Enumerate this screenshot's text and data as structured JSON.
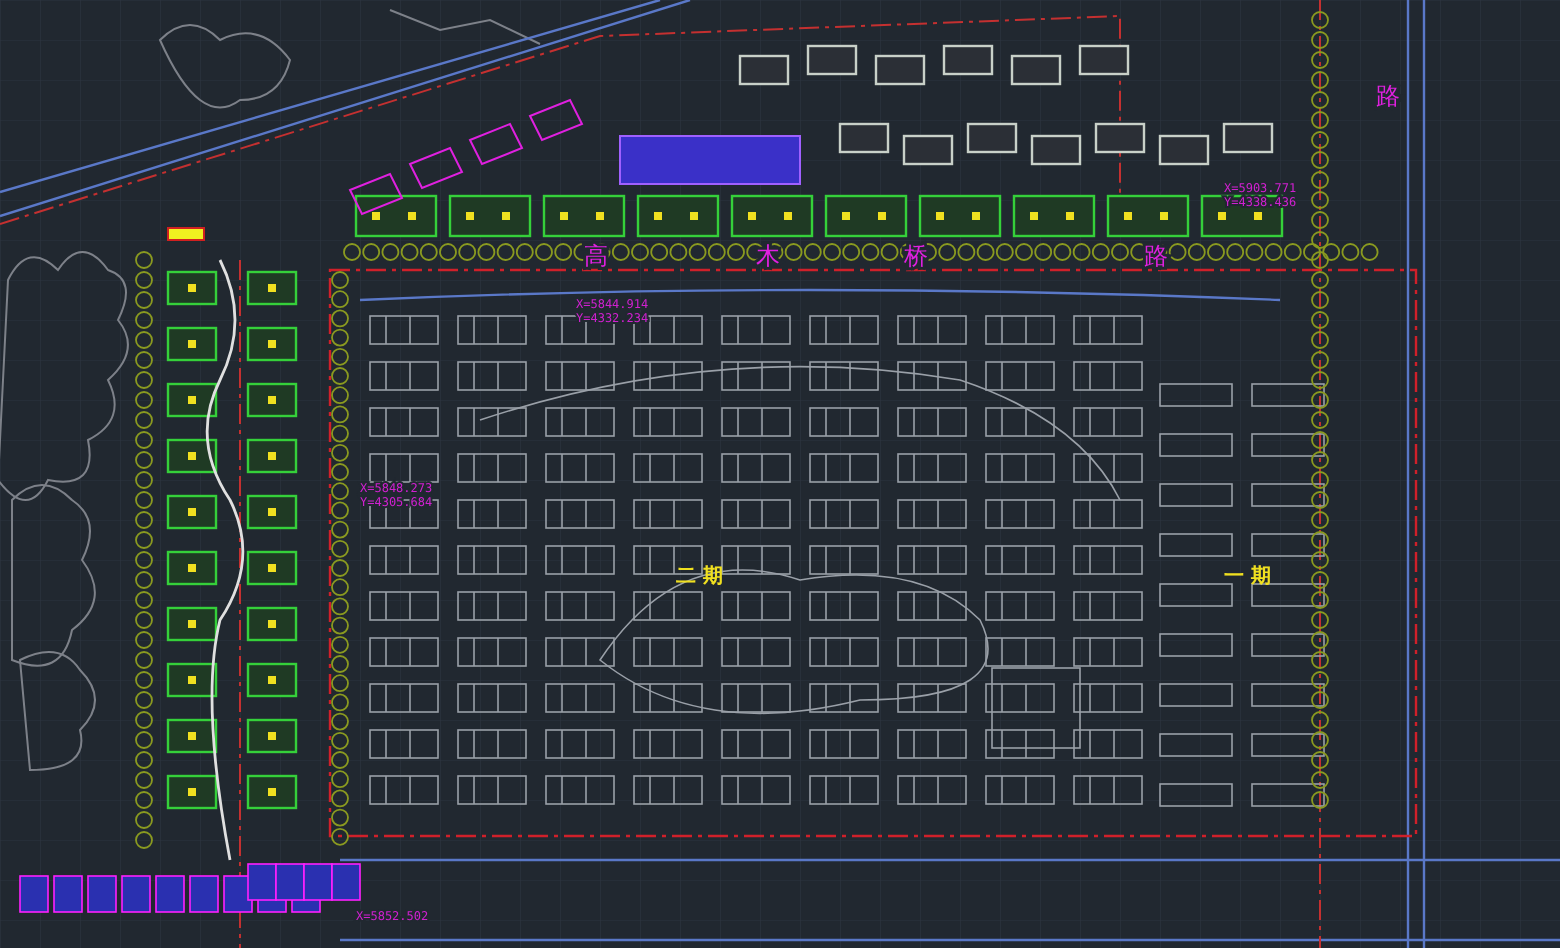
{
  "drawing": {
    "road_labels": [
      {
        "text": "高"
      },
      {
        "text": "木"
      },
      {
        "text": "桥"
      },
      {
        "text": "路"
      },
      {
        "text": "路"
      }
    ],
    "phase_labels": [
      {
        "text": "二 期"
      },
      {
        "text": "一 期"
      }
    ],
    "coordinate_labels": [
      {
        "lines": [
          "X=5844.914",
          "Y=4332.234"
        ]
      },
      {
        "lines": [
          "X=5848.273",
          "Y=4305.684"
        ]
      },
      {
        "lines": [
          "X=5903.771",
          "Y=4338.436"
        ]
      },
      {
        "lines": [
          "X=5852.502"
        ]
      }
    ]
  }
}
